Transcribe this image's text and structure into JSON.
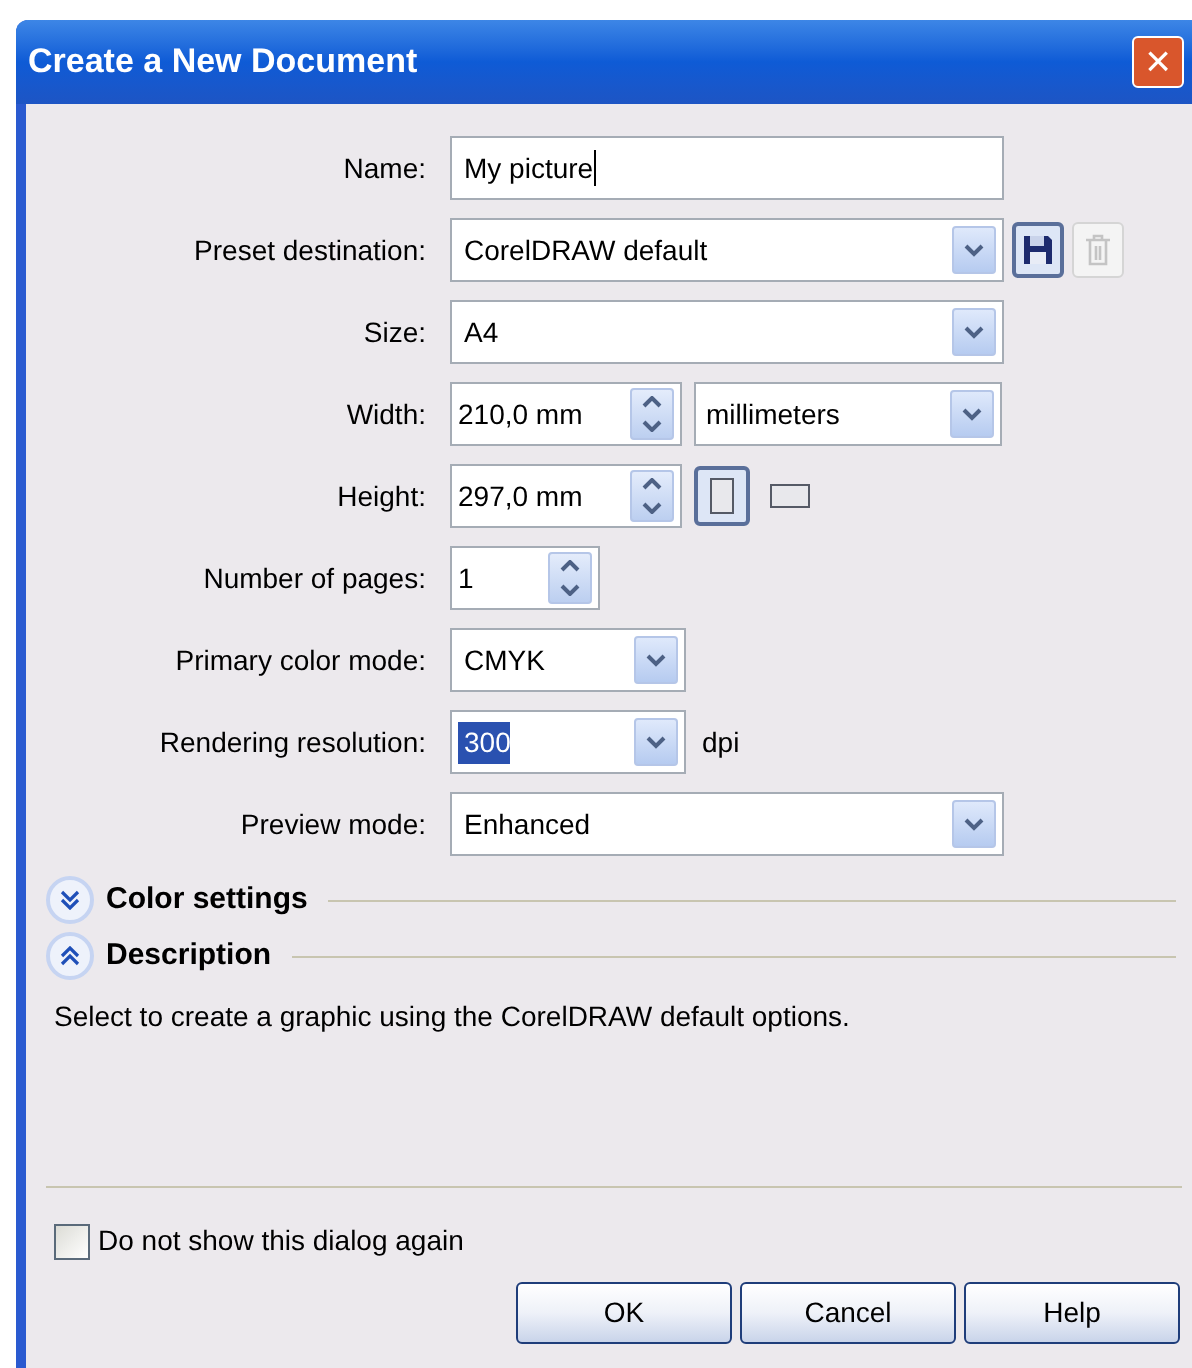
{
  "window": {
    "title": "Create a New Document",
    "close": "×"
  },
  "fields": [
    {
      "label": "Name:",
      "kind": "text",
      "value": "My picture",
      "focused": true
    },
    {
      "label": "Preset destination:",
      "kind": "preset",
      "value": "CorelDRAW default",
      "delete_enabled": false
    },
    {
      "label": "Size:",
      "kind": "combo",
      "value": "A4"
    },
    {
      "label": "Width:",
      "kind": "spin_units",
      "value": "210,0 mm",
      "unit": "millimeters"
    },
    {
      "label": "Height:",
      "kind": "spin_orientation",
      "value": "297,0 mm",
      "orientations": [
        {
          "kind": "portrait",
          "selected": true
        },
        {
          "kind": "landscape",
          "selected": false
        }
      ]
    },
    {
      "label": "Number of pages:",
      "kind": "spin_small",
      "value": "1"
    },
    {
      "label": "Primary color mode:",
      "kind": "combo_short",
      "value": "CMYK",
      "highlighted": false
    },
    {
      "label": "Rendering resolution:",
      "kind": "combo_short",
      "value": "300",
      "highlighted": true,
      "suffix": "dpi"
    },
    {
      "label": "Preview mode:",
      "kind": "combo",
      "value": "Enhanced"
    }
  ],
  "sections": [
    {
      "title": "Color settings",
      "expanded": false
    },
    {
      "title": "Description",
      "expanded": true,
      "text": "Select to create a graphic using the CorelDRAW default options."
    }
  ],
  "checkbox": {
    "label": "Do not show this dialog again",
    "checked": false
  },
  "buttons": [
    "OK",
    "Cancel",
    "Help"
  ]
}
